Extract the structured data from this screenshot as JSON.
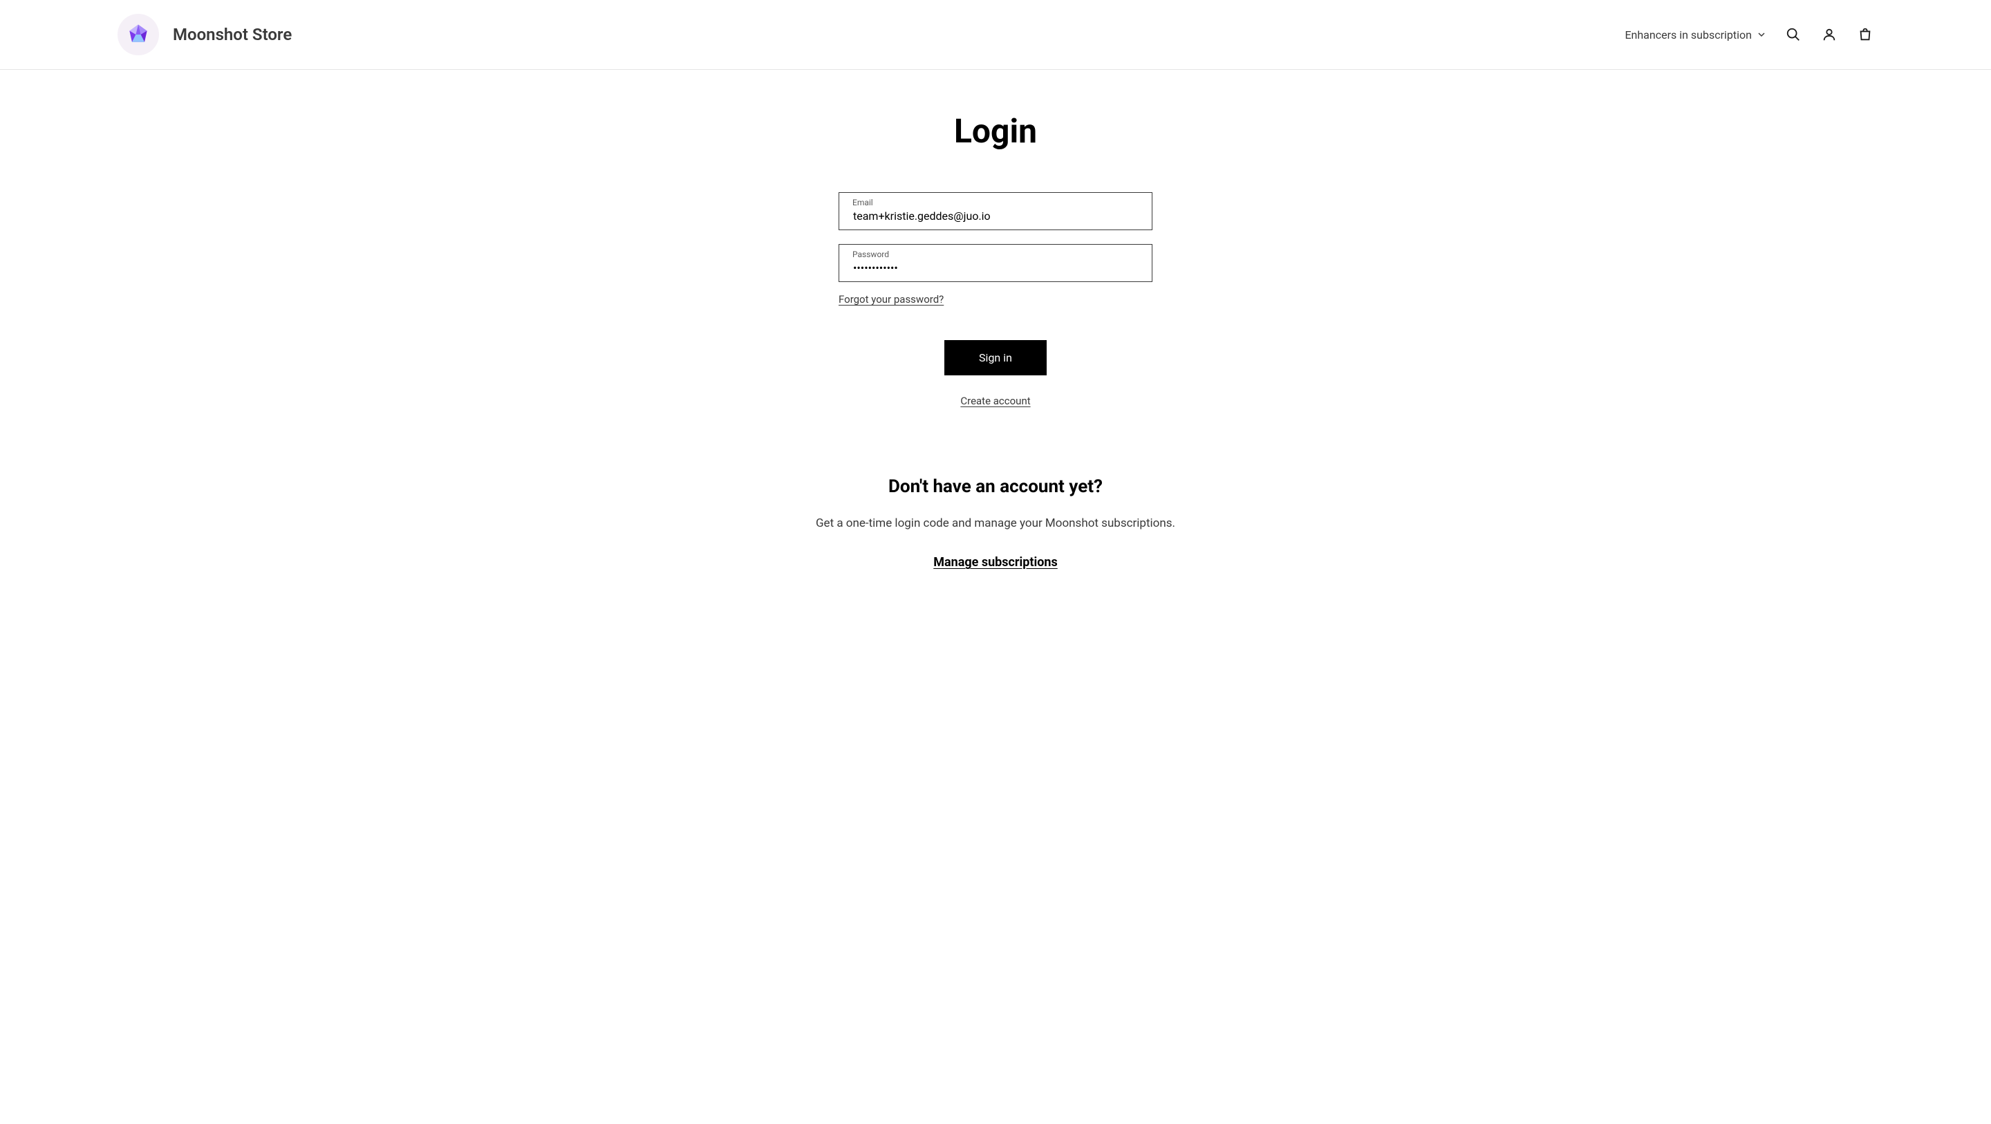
{
  "header": {
    "store_name": "Moonshot Store",
    "nav_item": "Enhancers in subscription"
  },
  "login": {
    "title": "Login",
    "email_label": "Email",
    "email_value": "team+kristie.geddes@juo.io",
    "password_label": "Password",
    "password_value": "••••••••••••",
    "forgot_link": "Forgot your password?",
    "signin_button": "Sign in",
    "create_link": "Create account"
  },
  "secondary": {
    "heading": "Don't have an account yet?",
    "text": "Get a one-time login code and manage your Moonshot subscriptions.",
    "manage_link": "Manage subscriptions"
  }
}
